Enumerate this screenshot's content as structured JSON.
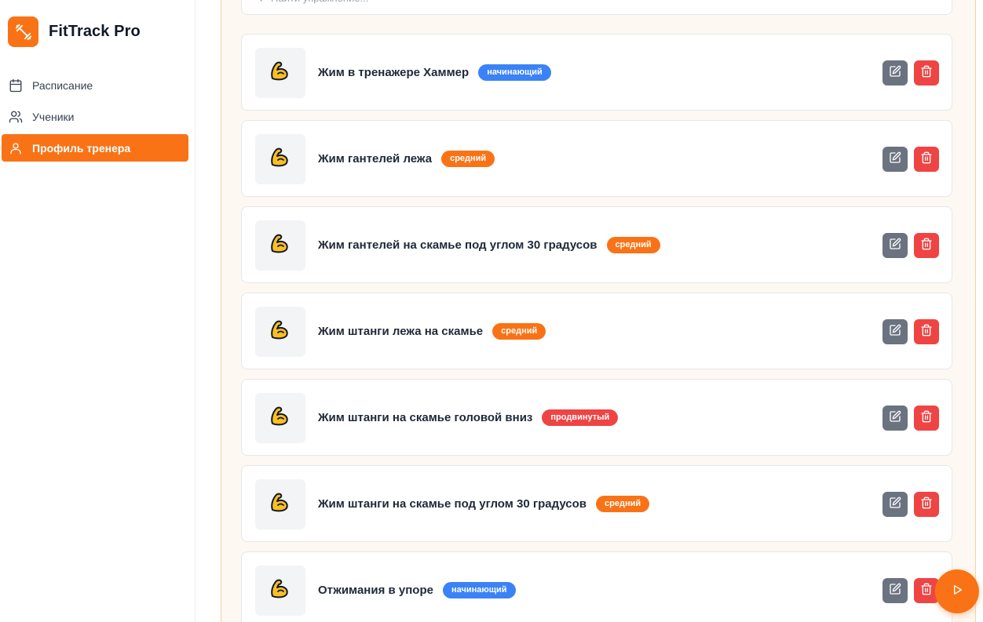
{
  "app": {
    "name": "FitTrack Pro"
  },
  "sidebar": {
    "items": [
      {
        "label": "Расписание",
        "icon": "calendar-icon",
        "active": false
      },
      {
        "label": "Ученики",
        "icon": "users-icon",
        "active": false
      },
      {
        "label": "Профиль тренера",
        "icon": "user-icon",
        "active": true
      }
    ]
  },
  "search": {
    "placeholder": "Найти упражнение..."
  },
  "exercises": [
    {
      "title": "Жим в тренажере Хаммер",
      "level": "начинающий",
      "level_type": "beginner"
    },
    {
      "title": "Жим гантелей лежа",
      "level": "средний",
      "level_type": "intermediate"
    },
    {
      "title": "Жим гантелей на скамье под углом 30 градусов",
      "level": "средний",
      "level_type": "intermediate"
    },
    {
      "title": "Жим штанги лежа на скамье",
      "level": "средний",
      "level_type": "intermediate"
    },
    {
      "title": "Жим штанги на скамье головой вниз",
      "level": "продвинутый",
      "level_type": "advanced"
    },
    {
      "title": "Жим штанги на скамье под углом 30 градусов",
      "level": "средний",
      "level_type": "intermediate"
    },
    {
      "title": "Отжимания в упоре",
      "level": "начинающий",
      "level_type": "beginner"
    }
  ],
  "colors": {
    "accent": "#f97316",
    "beginner": "#3b82f6",
    "intermediate": "#f97316",
    "advanced": "#ef4444",
    "edit": "#6b7280",
    "delete": "#ef4444"
  },
  "icons": {
    "exercise": "flexed-biceps-icon",
    "edit": "edit-icon",
    "delete": "trash-icon",
    "fab": "play-icon",
    "search": "search-icon"
  }
}
